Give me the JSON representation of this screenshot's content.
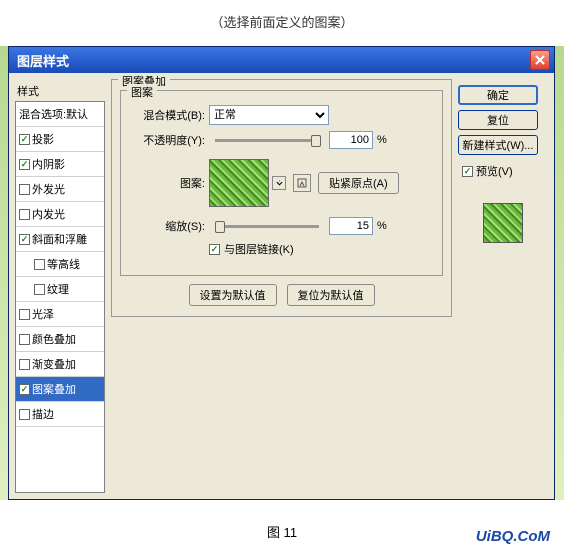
{
  "caption_top": "（选择前面定义的图案）",
  "caption_bottom": "图 11",
  "watermark": "UiBQ.CoM",
  "titlebar": {
    "title": "图层样式"
  },
  "styles_label": "样式",
  "blend_options": "混合选项:默认",
  "style_items": [
    {
      "label": "投影",
      "checked": true,
      "indent": false
    },
    {
      "label": "内阴影",
      "checked": true,
      "indent": false
    },
    {
      "label": "外发光",
      "checked": false,
      "indent": false
    },
    {
      "label": "内发光",
      "checked": false,
      "indent": false
    },
    {
      "label": "斜面和浮雕",
      "checked": true,
      "indent": false
    },
    {
      "label": "等高线",
      "checked": false,
      "indent": true
    },
    {
      "label": "纹理",
      "checked": false,
      "indent": true
    },
    {
      "label": "光泽",
      "checked": false,
      "indent": false
    },
    {
      "label": "颜色叠加",
      "checked": false,
      "indent": false
    },
    {
      "label": "渐变叠加",
      "checked": false,
      "indent": false
    },
    {
      "label": "图案叠加",
      "checked": true,
      "indent": false,
      "selected": true
    },
    {
      "label": "描边",
      "checked": false,
      "indent": false
    }
  ],
  "panel": {
    "title": "图案叠加",
    "group": "图案",
    "blend_mode_label": "混合模式(B):",
    "blend_mode_value": "正常",
    "opacity_label": "不透明度(Y):",
    "opacity_value": "100",
    "percent": "%",
    "pattern_label": "图案:",
    "snap_origin": "贴紧原点(A)",
    "scale_label": "缩放(S):",
    "scale_value": "15",
    "link_layer": "与图层链接(K)",
    "set_default": "设置为默认值",
    "reset_default": "复位为默认值"
  },
  "right": {
    "ok": "确定",
    "reset": "复位",
    "new_style": "新建样式(W)...",
    "preview": "预览(V)"
  }
}
